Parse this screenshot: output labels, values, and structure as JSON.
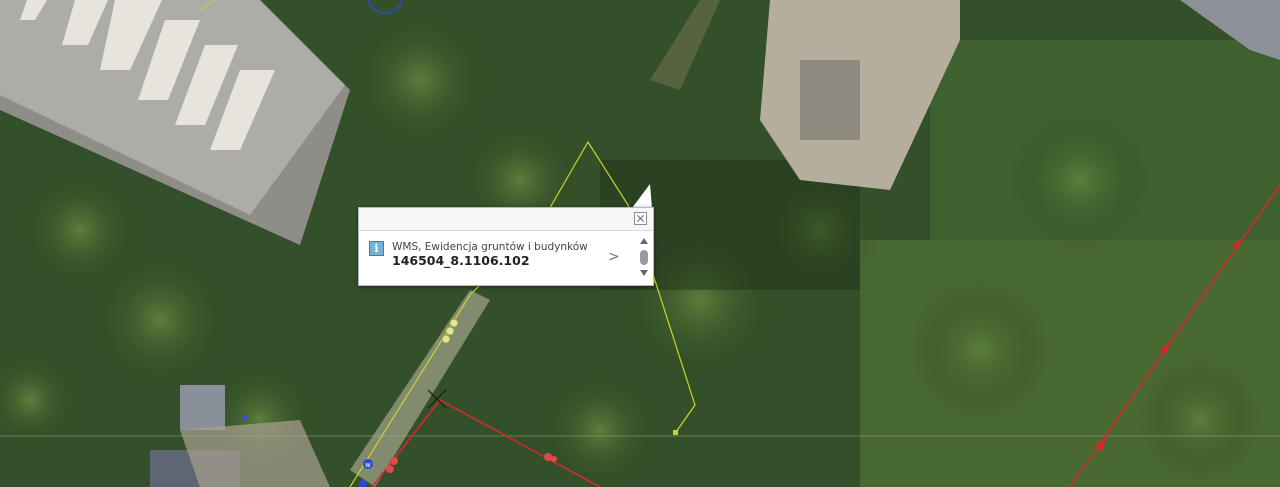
{
  "map": {
    "colors": {
      "vegetation": "#3b5a2a",
      "roof": "#a9a7a0",
      "parcel_line": "#c9d62a",
      "boundary_line": "#d42a2a",
      "pavement": "#bdb6a6"
    },
    "markers": [
      {
        "symbol": "w"
      },
      {
        "symbol": "o"
      }
    ]
  },
  "popup": {
    "layer_name": "WMS, Ewidencja gruntów i budynków",
    "feature_id": "146504_8.1106.102",
    "icon": "info-icon",
    "close_icon": "close-icon",
    "next_icon": "chevron-right-icon",
    "next_glyph": ">"
  }
}
